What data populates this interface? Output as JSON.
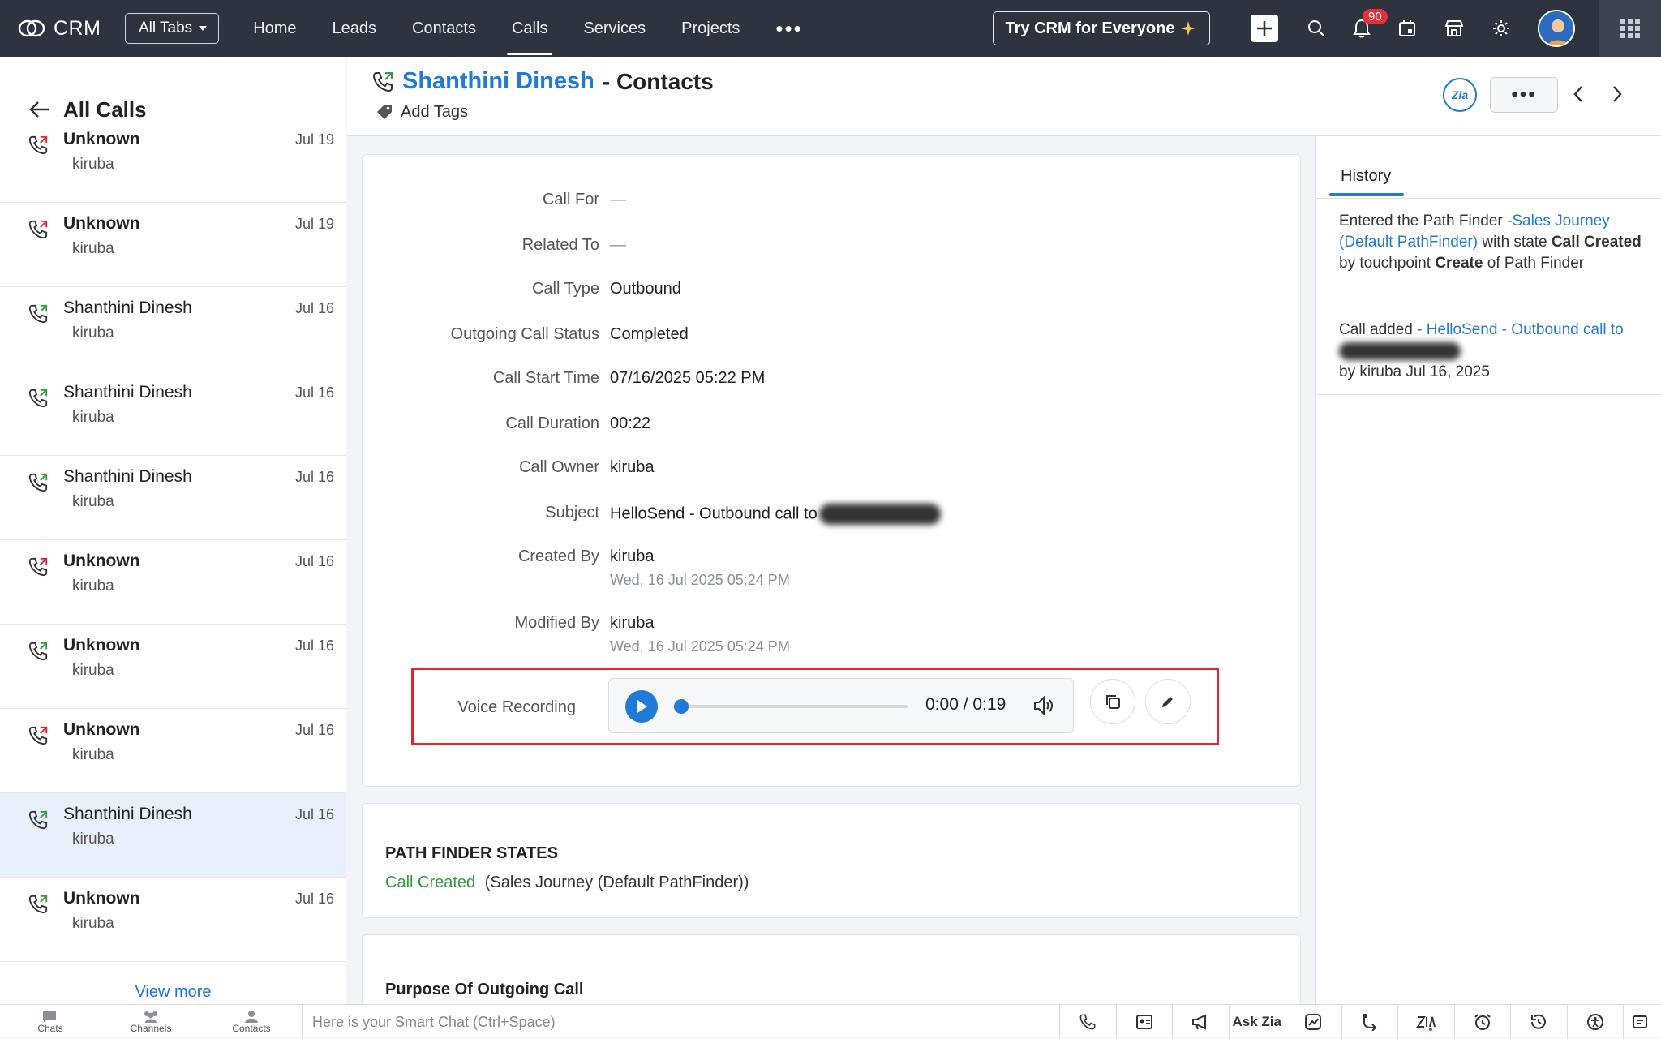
{
  "nav": {
    "brand": "CRM",
    "all_tabs": "All Tabs",
    "items": [
      "Home",
      "Leads",
      "Contacts",
      "Calls",
      "Services",
      "Projects"
    ],
    "more": "•••",
    "try_button": "Try CRM for Everyone",
    "notification_count": "90"
  },
  "left_pane": {
    "title": "All Calls",
    "calls": [
      {
        "name": "Unknown",
        "owner": "kiruba",
        "date": "Jul 19",
        "direction": "outgoing-missed"
      },
      {
        "name": "Unknown",
        "owner": "kiruba",
        "date": "Jul 19",
        "direction": "outgoing-missed"
      },
      {
        "name": "Shanthini Dinesh",
        "owner": "kiruba",
        "date": "Jul 16",
        "direction": "outgoing"
      },
      {
        "name": "Shanthini Dinesh",
        "owner": "kiruba",
        "date": "Jul 16",
        "direction": "outgoing"
      },
      {
        "name": "Shanthini Dinesh",
        "owner": "kiruba",
        "date": "Jul 16",
        "direction": "outgoing"
      },
      {
        "name": "Unknown",
        "owner": "kiruba",
        "date": "Jul 16",
        "direction": "outgoing-missed"
      },
      {
        "name": "Unknown",
        "owner": "kiruba",
        "date": "Jul 16",
        "direction": "outgoing"
      },
      {
        "name": "Unknown",
        "owner": "kiruba",
        "date": "Jul 16",
        "direction": "outgoing-missed"
      },
      {
        "name": "Shanthini Dinesh",
        "owner": "kiruba",
        "date": "Jul 16",
        "direction": "outgoing",
        "selected": true
      },
      {
        "name": "Unknown",
        "owner": "kiruba",
        "date": "Jul 16",
        "direction": "outgoing"
      }
    ],
    "view_more": "View more"
  },
  "header": {
    "contact_name": "Shanthini Dinesh",
    "module": " - Contacts",
    "add_tags": "Add Tags",
    "zia": "Zia",
    "more": "•••"
  },
  "details": {
    "fields": [
      {
        "label": "Call For",
        "value": "—"
      },
      {
        "label": "Related To",
        "value": "—"
      },
      {
        "label": "Call Type",
        "value": "Outbound"
      },
      {
        "label": "Outgoing Call Status",
        "value": "Completed"
      },
      {
        "label": "Call Start Time",
        "value": "07/16/2025 05:22 PM"
      },
      {
        "label": "Call Duration",
        "value": "00:22"
      },
      {
        "label": "Call Owner",
        "value": "kiruba"
      },
      {
        "label": "Subject",
        "value": "HelloSend - Outbound call to"
      },
      {
        "label": "Created By",
        "value": "kiruba",
        "sub": "Wed, 16 Jul 2025 05:24 PM"
      },
      {
        "label": "Modified By",
        "value": "kiruba",
        "sub": "Wed, 16 Jul 2025 05:24 PM"
      }
    ],
    "voice_recording": {
      "label": "Voice Recording",
      "time": "0:00 / 0:19",
      "progress": 0
    }
  },
  "path_finder": {
    "title": "PATH FINDER STATES",
    "state": "Call Created",
    "journey": "(Sales Journey (Default PathFinder))"
  },
  "purpose": {
    "title": "Purpose Of Outgoing Call"
  },
  "history": {
    "tab": "History",
    "item1": {
      "t1": "Entered the Path Finder -",
      "link": "Sales Journey (Default PathFinder)",
      "t2": " with state ",
      "b1": "Call Created",
      "t3": " by touchpoint ",
      "b2": "Create",
      "t4": " of Path Finder"
    },
    "item2": {
      "t1": "Call added ",
      "link": " - HelloSend - Outbound call to",
      "by": "by kiruba Jul 16, 2025"
    }
  },
  "bottom": {
    "tabs": [
      "Chats",
      "Channels",
      "Contacts"
    ],
    "smart_chat": "Here is your Smart Chat (Ctrl+Space)",
    "ask_zia": "Ask Zia"
  },
  "colors": {
    "accent": "#1f7ad8",
    "nav_bg": "#2e3340",
    "highlight_border": "#e1262f",
    "success": "#2e9d3a",
    "missed": "#e1262f"
  }
}
